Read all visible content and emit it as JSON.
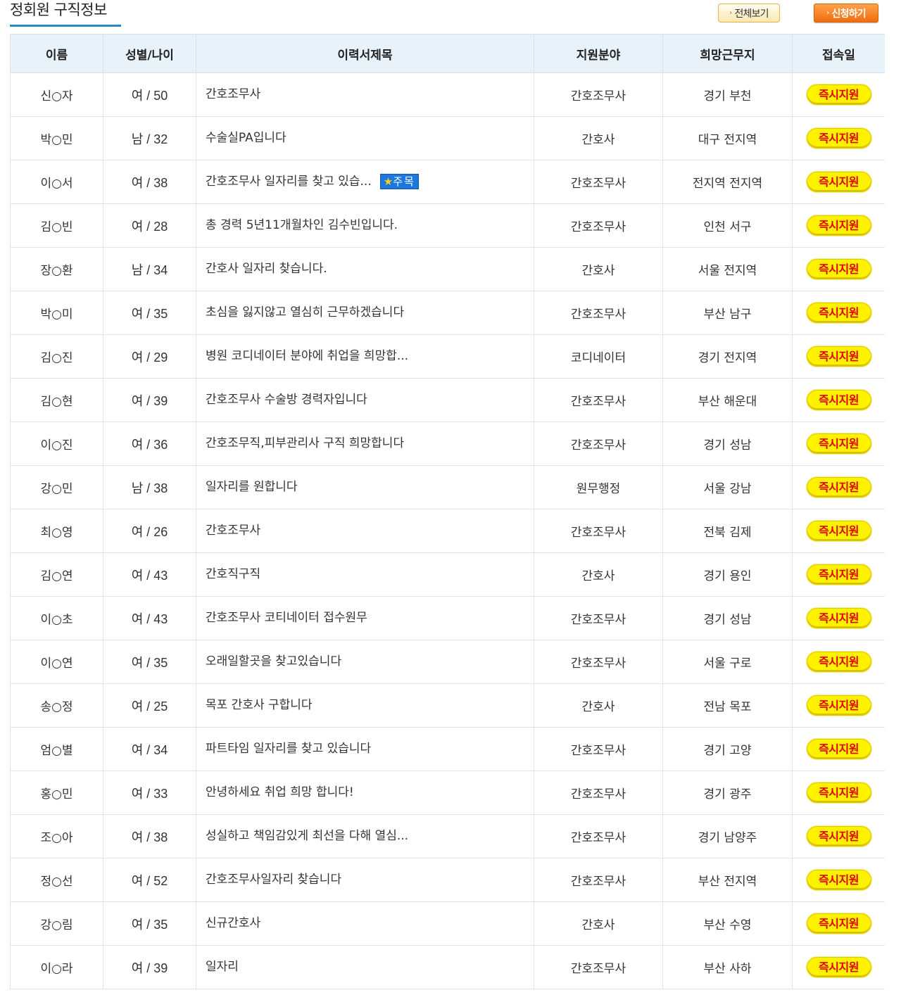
{
  "page": {
    "title": "정회원 구직정보",
    "view_all_label": "전체보기",
    "apply_label": "신청하기",
    "arrow_glyph": "›"
  },
  "columns": [
    "이름",
    "성별/나이",
    "이력서제목",
    "지원분야",
    "희망근무지",
    "접속일"
  ],
  "rows": [
    {
      "name": "신○자",
      "sex_age": "여 / 50",
      "title": "간호조무사",
      "field": "간호조무사",
      "location": "경기 부천",
      "action": "즉시지원"
    },
    {
      "name": "박○민",
      "sex_age": "남 / 32",
      "title": "수술실PA입니다",
      "field": "간호사",
      "location": "대구 전지역",
      "action": "즉시지원"
    },
    {
      "name": "이○서",
      "sex_age": "여 / 38",
      "title": "간호조무사 일자리를 찾고 있습...",
      "badge": "주목",
      "field": "간호조무사",
      "location": "전지역 전지역",
      "action": "즉시지원"
    },
    {
      "name": "김○빈",
      "sex_age": "여 / 28",
      "title": "총 경력 5년11개월차인 김수빈입니다.",
      "field": "간호조무사",
      "location": "인천 서구",
      "action": "즉시지원"
    },
    {
      "name": "장○환",
      "sex_age": "남 / 34",
      "title": "간호사 일자리 찾습니다.",
      "field": "간호사",
      "location": "서울 전지역",
      "action": "즉시지원"
    },
    {
      "name": "박○미",
      "sex_age": "여 / 35",
      "title": "초심을 잃지않고 열심히 근무하겠습니다",
      "field": "간호조무사",
      "location": "부산 남구",
      "action": "즉시지원"
    },
    {
      "name": "김○진",
      "sex_age": "여 / 29",
      "title": "병원 코디네이터 분야에 취업을 희망합...",
      "field": "코디네이터",
      "location": "경기 전지역",
      "action": "즉시지원"
    },
    {
      "name": "김○현",
      "sex_age": "여 / 39",
      "title": "간호조무사 수술방 경력자입니다",
      "field": "간호조무사",
      "location": "부산 해운대",
      "action": "즉시지원"
    },
    {
      "name": "이○진",
      "sex_age": "여 / 36",
      "title": "간호조무직,피부관리사 구직 희망합니다",
      "field": "간호조무사",
      "location": "경기 성남",
      "action": "즉시지원"
    },
    {
      "name": "강○민",
      "sex_age": "남 / 38",
      "title": "일자리를 원합니다",
      "field": "원무행정",
      "location": "서울 강남",
      "action": "즉시지원"
    },
    {
      "name": "최○영",
      "sex_age": "여 / 26",
      "title": "간호조무사",
      "field": "간호조무사",
      "location": "전북 김제",
      "action": "즉시지원"
    },
    {
      "name": "김○연",
      "sex_age": "여 / 43",
      "title": "간호직구직",
      "field": "간호사",
      "location": "경기 용인",
      "action": "즉시지원"
    },
    {
      "name": "이○초",
      "sex_age": "여 / 43",
      "title": "간호조무사 코티네이터 접수원무",
      "field": "간호조무사",
      "location": "경기 성남",
      "action": "즉시지원"
    },
    {
      "name": "이○연",
      "sex_age": "여 / 35",
      "title": "오래일할곳을 찾고있습니다",
      "field": "간호조무사",
      "location": "서울 구로",
      "action": "즉시지원"
    },
    {
      "name": "송○정",
      "sex_age": "여 / 25",
      "title": "목포 간호사 구합니다",
      "field": "간호사",
      "location": "전남 목포",
      "action": "즉시지원"
    },
    {
      "name": "엄○별",
      "sex_age": "여 / 34",
      "title": "파트타임 일자리를 찾고 있습니다",
      "field": "간호조무사",
      "location": "경기 고양",
      "action": "즉시지원"
    },
    {
      "name": "홍○민",
      "sex_age": "여 / 33",
      "title": "안녕하세요 취업 희망 합니다!",
      "field": "간호조무사",
      "location": "경기 광주",
      "action": "즉시지원"
    },
    {
      "name": "조○아",
      "sex_age": "여 / 38",
      "title": "성실하고 책임감있게 최선을 다해 열심...",
      "field": "간호조무사",
      "location": "경기 남양주",
      "action": "즉시지원"
    },
    {
      "name": "정○선",
      "sex_age": "여 / 52",
      "title": "간호조무사일자리 찾습니다",
      "field": "간호조무사",
      "location": "부산 전지역",
      "action": "즉시지원"
    },
    {
      "name": "강○림",
      "sex_age": "여 / 35",
      "title": "신규간호사",
      "field": "간호사",
      "location": "부산 수영",
      "action": "즉시지원"
    },
    {
      "name": "이○라",
      "sex_age": "여 / 39",
      "title": "일자리",
      "field": "간호조무사",
      "location": "부산 사하",
      "action": "즉시지원"
    }
  ]
}
